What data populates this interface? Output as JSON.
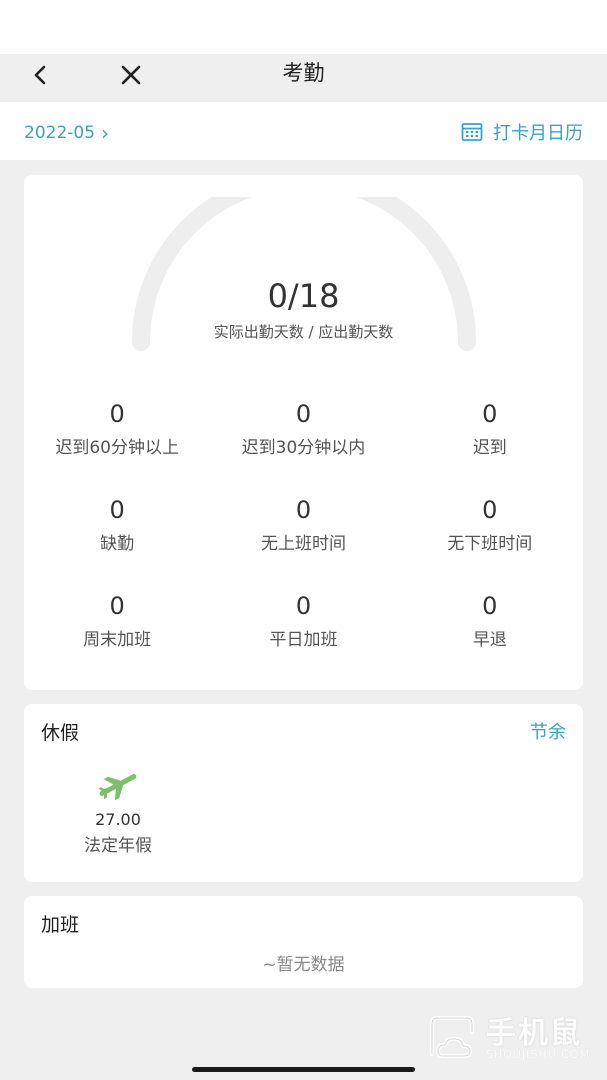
{
  "header": {
    "title": "考勤"
  },
  "month_bar": {
    "month": "2022-05",
    "chevron": "›",
    "calendar_label": "打卡月日历",
    "calendar_icon": "calendar-icon"
  },
  "summary": {
    "attendance_value": "0/18",
    "attendance_caption": "实际出勤天数 / 应出勤天数",
    "progress_fraction": 0,
    "stats": [
      {
        "value": "0",
        "label": "迟到60分钟以上"
      },
      {
        "value": "0",
        "label": "迟到30分钟以内"
      },
      {
        "value": "0",
        "label": "迟到"
      },
      {
        "value": "0",
        "label": "缺勤"
      },
      {
        "value": "0",
        "label": "无上班时间"
      },
      {
        "value": "0",
        "label": "无下班时间"
      },
      {
        "value": "0",
        "label": "周末加班"
      },
      {
        "value": "0",
        "label": "平日加班"
      },
      {
        "value": "0",
        "label": "早退"
      }
    ]
  },
  "leave": {
    "title": "休假",
    "action": "节余",
    "items": [
      {
        "icon": "airplane-icon",
        "value": "27.00",
        "label": "法定年假"
      }
    ]
  },
  "overtime": {
    "title": "加班",
    "empty": "~暂无数据"
  },
  "watermark": {
    "cn": "手机鼠",
    "en": "SHOUJISHU.COM"
  },
  "colors": {
    "accent": "#3aa1c6",
    "gauge_track": "#eeeeee",
    "leave_icon": "#7cbf6a"
  }
}
